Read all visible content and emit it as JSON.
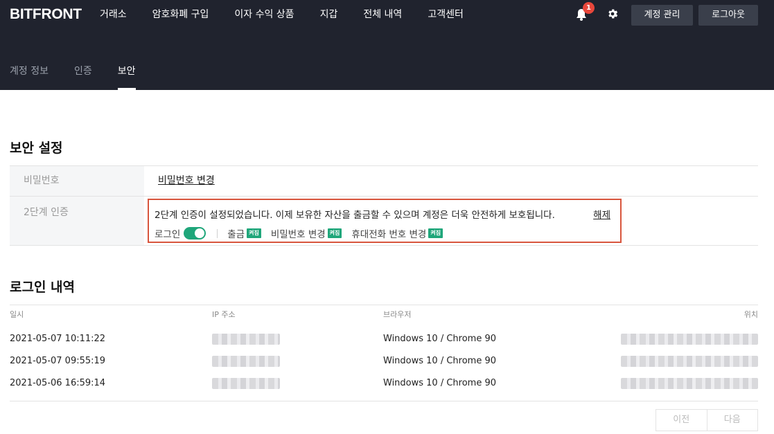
{
  "header": {
    "logo": "BITFRONT",
    "nav": [
      "거래소",
      "암호화폐 구입",
      "이자 수익 상품",
      "지갑",
      "전체 내역",
      "고객센터"
    ],
    "notification_count": "1",
    "account_button": "계정 관리",
    "logout_button": "로그아웃"
  },
  "subtabs": [
    {
      "label": "계정 정보",
      "active": false
    },
    {
      "label": "인증",
      "active": false
    },
    {
      "label": "보안",
      "active": true
    }
  ],
  "security": {
    "title": "보안 설정",
    "password_label": "비밀번호",
    "password_link": "비밀번호 변경",
    "twofa_label": "2단계 인증",
    "twofa_message": "2단계 인증이 설정되었습니다. 이제 보유한 자산을 출금할 수 있으며 계정은 더욱 안전하게 보호됩니다.",
    "twofa_release": "해제",
    "login_option": "로그인",
    "login_toggle_on": true,
    "options": [
      {
        "label": "출금",
        "badge": "켜짐"
      },
      {
        "label": "비밀번호 변경",
        "badge": "켜짐"
      },
      {
        "label": "휴대전화 번호 변경",
        "badge": "켜짐"
      }
    ]
  },
  "login_history": {
    "title": "로그인 내역",
    "columns": {
      "date": "일시",
      "ip": "IP 주소",
      "browser": "브라우저",
      "location": "위치"
    },
    "rows": [
      {
        "date": "2021-05-07 10:11:22",
        "browser": "Windows 10 / Chrome 90"
      },
      {
        "date": "2021-05-07 09:55:19",
        "browser": "Windows 10 / Chrome 90"
      },
      {
        "date": "2021-05-06 16:59:14",
        "browser": "Windows 10 / Chrome 90"
      }
    ]
  },
  "pager": {
    "prev": "이전",
    "next": "다음"
  },
  "colors": {
    "header_bg": "#20232e",
    "accent_green": "#1fa67a",
    "highlight_border": "#d8553d",
    "badge_red": "#e8473b"
  }
}
